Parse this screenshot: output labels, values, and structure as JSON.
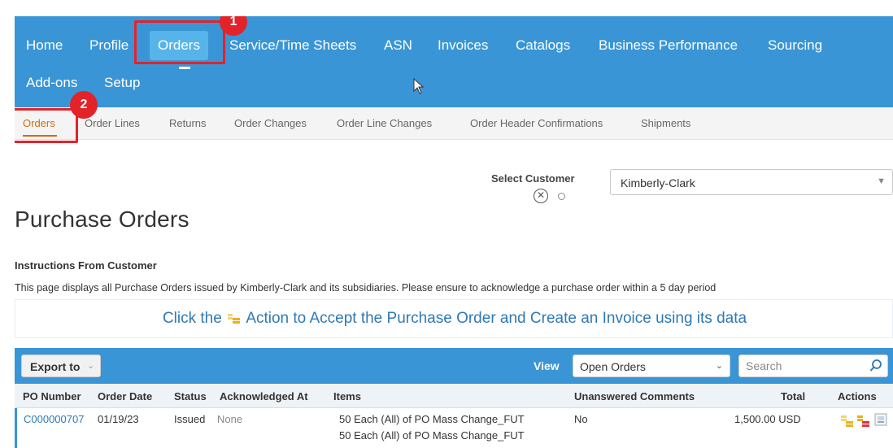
{
  "topnav": {
    "items": [
      "Home",
      "Profile",
      "Orders",
      "Service/Time Sheets",
      "ASN",
      "Invoices",
      "Catalogs",
      "Business Performance",
      "Sourcing",
      "Add-ons",
      "Setup"
    ],
    "active": "Orders"
  },
  "annotations": {
    "badge1": "1",
    "badge2": "2"
  },
  "subnav": {
    "items": [
      "Orders",
      "Order Lines",
      "Returns",
      "Order Changes",
      "Order Line Changes",
      "Order Header Confirmations",
      "Shipments"
    ],
    "active": "Orders"
  },
  "customer": {
    "label": "Select Customer",
    "value": "Kimberly-Clark"
  },
  "page": {
    "title": "Purchase Orders",
    "instructions_heading": "Instructions From Customer",
    "instructions_text": "This page displays all Purchase Orders issued by Kimberly-Clark and its subsidiaries. Please ensure to acknowledge a purchase order within a 5 day period",
    "cta_before": "Click the",
    "cta_after": "Action to Accept the Purchase Order and Create an Invoice using its data"
  },
  "toolbar": {
    "export_label": "Export to",
    "view_label": "View",
    "view_value": "Open Orders",
    "search_placeholder": "Search"
  },
  "table": {
    "columns": [
      "PO Number",
      "Order Date",
      "Status",
      "Acknowledged At",
      "Items",
      "Unanswered Comments",
      "Total",
      "Actions"
    ],
    "rows": [
      {
        "po_number": "C000000707",
        "order_date": "01/19/23",
        "status": "Issued",
        "acknowledged_at": "None",
        "items": [
          "50 Each (All) of PO Mass Change_FUT",
          "50 Each (All) of PO Mass Change_FUT"
        ],
        "unanswered_comments": "No",
        "total": "1,500.00 USD"
      }
    ]
  },
  "colors": {
    "nav_bg": "#3a95d6",
    "nav_active": "#57b4ea",
    "highlight": "#e2232a",
    "subnav_active": "#d26b10",
    "link": "#2f79b5"
  },
  "icons": [
    "search-icon",
    "invoice-coins-icon",
    "reject-coins-icon",
    "printer-icon",
    "chevron-down-icon",
    "mouse-cursor-icon"
  ]
}
